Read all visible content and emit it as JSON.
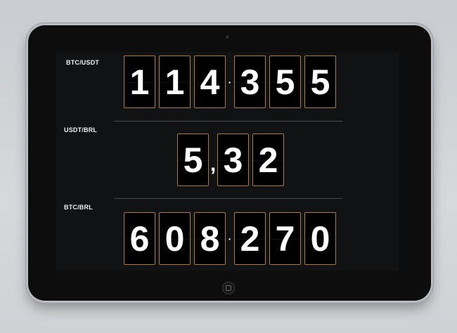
{
  "rows": [
    {
      "label": "BTC/USDT",
      "digits": [
        "1",
        "1",
        "4",
        "3",
        "5",
        "5"
      ],
      "separator": "·",
      "separator_after": 3
    },
    {
      "label": "USDT/BRL",
      "digits": [
        "5",
        "3",
        "2"
      ],
      "separator": ",",
      "separator_after": 1
    },
    {
      "label": "BTC/BRL",
      "digits": [
        "6",
        "0",
        "8",
        "2",
        "7",
        "0"
      ],
      "separator": "·",
      "separator_after": 3
    }
  ],
  "colors": {
    "tile_border": "#b07a3c",
    "tile_bg": "#000000",
    "digit": "#ffffff",
    "screen_bg": "#111214"
  }
}
